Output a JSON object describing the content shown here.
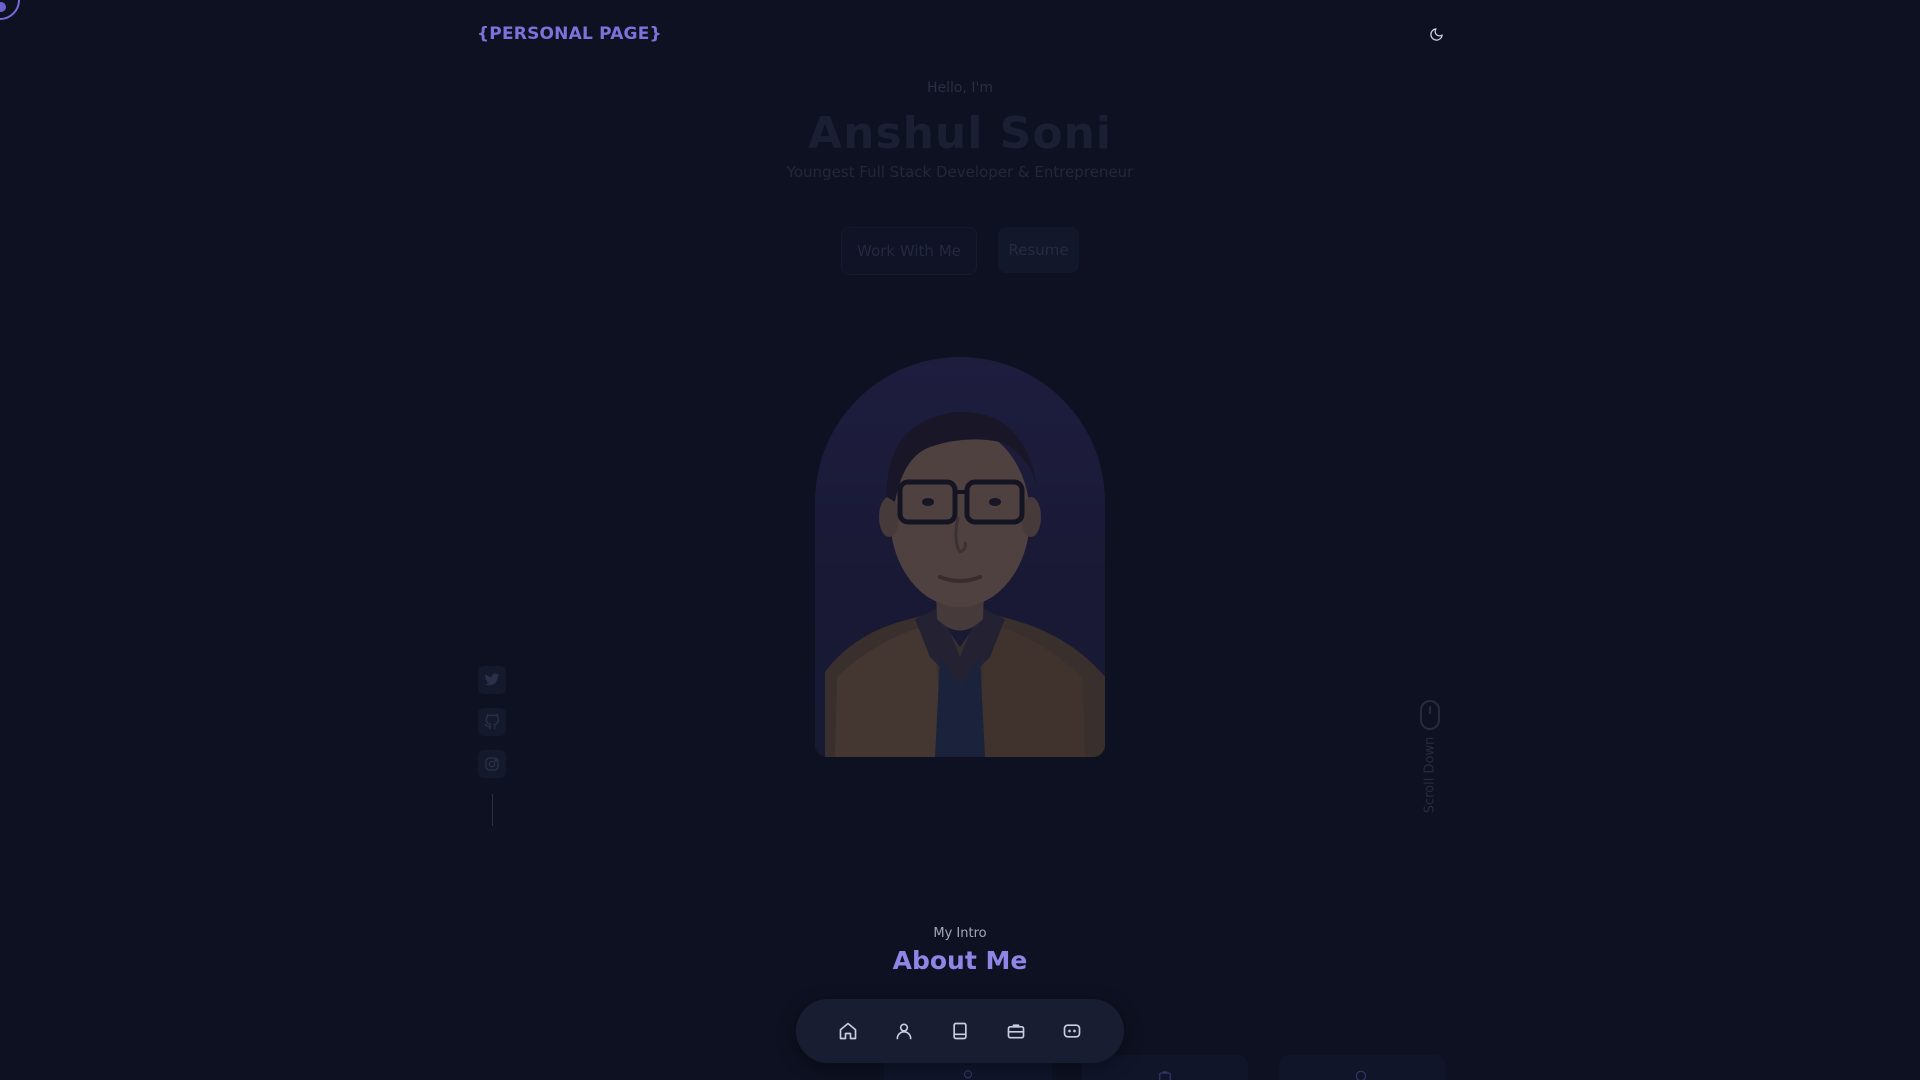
{
  "header": {
    "logo": "{PERSONAL PAGE}",
    "theme_toggle_icon": "moon-icon"
  },
  "hero": {
    "greeting": "Hello, I'm",
    "name": "Anshul Soni",
    "role": "Youngest Full Stack Developer & Entrepreneur",
    "primary_button": "Work With Me",
    "secondary_button": "Resume"
  },
  "social": {
    "icons": [
      "twitter-icon",
      "github-icon",
      "instagram-icon"
    ]
  },
  "scroll": {
    "label": "Scroll Down",
    "icon": "mouse-icon"
  },
  "section": {
    "subtitle": "My Intro",
    "title": "About Me"
  },
  "bottom_nav": {
    "items": [
      "home-icon",
      "user-icon",
      "book-icon",
      "briefcase-icon",
      "message-icon"
    ]
  },
  "colors": {
    "background": "#0d1121",
    "accent": "#8f85e6",
    "nav_background": "#181d32"
  }
}
